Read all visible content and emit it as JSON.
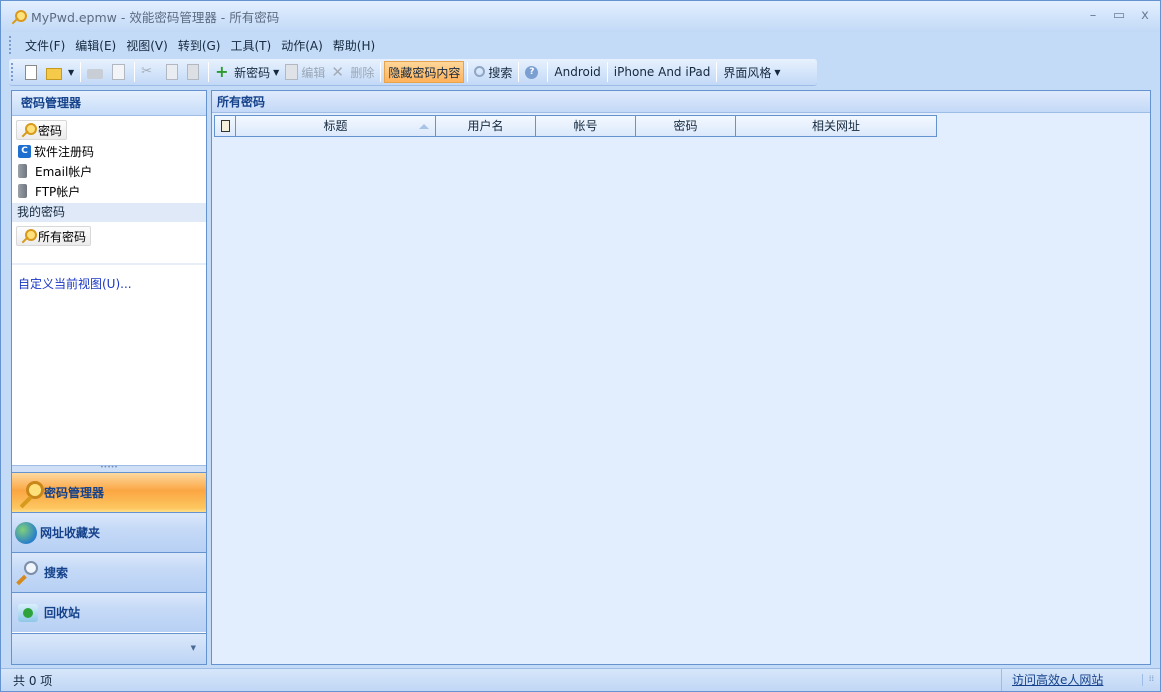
{
  "window": {
    "title": "MyPwd.epmw - 效能密码管理器 - 所有密码",
    "controls": {
      "minimize": "–",
      "maximize": "▭",
      "close": "x"
    }
  },
  "menu": [
    "文件(F)",
    "编辑(E)",
    "视图(V)",
    "转到(G)",
    "工具(T)",
    "动作(A)",
    "帮助(H)"
  ],
  "toolbar": {
    "new_password": "新密码",
    "edit": "编辑",
    "delete": "删除",
    "hide_content": "隐藏密码内容",
    "search": "搜索",
    "android": "Android",
    "iphone": "iPhone And iPad",
    "theme": "界面风格"
  },
  "left_pane": {
    "header": "密码管理器",
    "items": [
      {
        "label": "密码",
        "icon": "key-icon",
        "selected": true
      },
      {
        "label": "软件注册码",
        "icon": "c-app-icon",
        "selected": false
      },
      {
        "label": "Email帐户",
        "icon": "email-account-icon",
        "selected": false
      },
      {
        "label": "FTP帐户",
        "icon": "ftp-account-icon",
        "selected": false
      }
    ],
    "group_label": "我的密码",
    "group_items": [
      {
        "label": "所有密码",
        "icon": "key-icon",
        "selected": true
      }
    ],
    "customize_link": "自定义当前视图(U)...",
    "nav_buttons": [
      {
        "label": "密码管理器",
        "icon": "key-icon",
        "active": true
      },
      {
        "label": "网址收藏夹",
        "icon": "globe-lock-icon",
        "active": false
      },
      {
        "label": "搜索",
        "icon": "magnifier-icon",
        "active": false
      },
      {
        "label": "回收站",
        "icon": "recycle-bin-icon",
        "active": false
      }
    ]
  },
  "main": {
    "header": "所有密码",
    "columns": [
      "标题",
      "用户名",
      "帐号",
      "密码",
      "相关网址"
    ],
    "rows": []
  },
  "status": {
    "count": "共 0 项",
    "link": "访问高效e人网站"
  },
  "colors": {
    "accent_orange": "#fba643",
    "header_text": "#15428b",
    "border_blue": "#6593cf"
  }
}
